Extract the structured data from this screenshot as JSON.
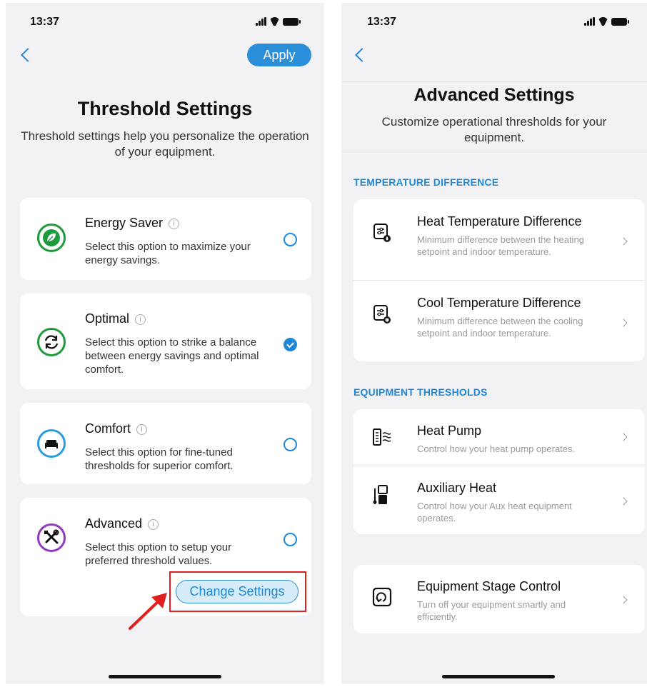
{
  "left_screen": {
    "status": {
      "time": "13:37"
    },
    "header": {
      "apply_label": "Apply"
    },
    "title": "Threshold Settings",
    "subtitle": "Threshold settings help you personalize the operation of your equipment.",
    "info_glyph": "i",
    "options": [
      {
        "title": "Energy Saver",
        "description": "Select this option to maximize your energy savings.",
        "icon": "leaf-icon",
        "icon_color": "#1e9a3c",
        "selected": false
      },
      {
        "title": "Optimal",
        "description": "Select this option to strike a balance between energy savings and optimal comfort.",
        "icon": "cycle-icon",
        "icon_color": "#1e9a3c",
        "selected": true
      },
      {
        "title": "Comfort",
        "description": "Select this option for fine-tuned thresholds for superior comfort.",
        "icon": "bed-icon",
        "icon_color": "#2b9be0",
        "selected": false
      },
      {
        "title": "Advanced",
        "description": "Select this option to setup your preferred threshold values.",
        "icon": "tools-icon",
        "icon_color": "#8e3bbf",
        "selected": false
      }
    ],
    "change_settings_label": "Change Settings"
  },
  "right_screen": {
    "status": {
      "time": "13:37"
    },
    "title": "Advanced Settings",
    "subtitle": "Customize operational thresholds for your equipment.",
    "sections": [
      {
        "header": "TEMPERATURE DIFFERENCE",
        "items": [
          {
            "title": "Heat Temperature Difference",
            "description": "Minimum difference between the heating setpoint and indoor temperature.",
            "icon": "heat-difference-icon"
          },
          {
            "title": "Cool Temperature Difference",
            "description": "Minimum difference between the cooling setpoint and indoor temperature.",
            "icon": "cool-difference-icon"
          }
        ]
      },
      {
        "header": "EQUIPMENT THRESHOLDS",
        "items": [
          {
            "title": "Heat Pump",
            "description": "Control how your heat pump operates.",
            "icon": "heat-pump-icon"
          },
          {
            "title": "Auxiliary Heat",
            "description": "Control how your Aux heat equipment operates.",
            "icon": "aux-heat-icon"
          }
        ]
      }
    ],
    "stage_control": {
      "title": "Equipment Stage Control",
      "description": "Turn off your equipment smartly and efficiently.",
      "icon": "stage-control-icon"
    }
  },
  "colors": {
    "accent": "#1e88d8",
    "apply_bg": "#2b8ed9",
    "highlight_red": "#e02020",
    "background": "#f2f2f4"
  }
}
